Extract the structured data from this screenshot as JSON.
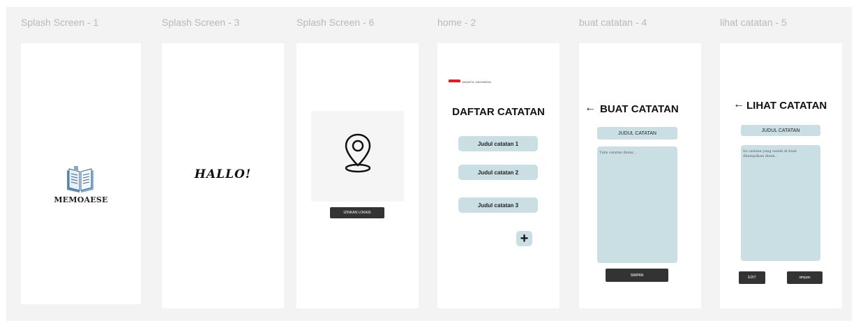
{
  "frames": [
    {
      "title": "Splash Screen - 1"
    },
    {
      "title": "Splash Screen - 3"
    },
    {
      "title": "Splash Screen - 6"
    },
    {
      "title": "home - 2"
    },
    {
      "title": "buat catatan - 4"
    },
    {
      "title": "lihat catatan - 5"
    }
  ],
  "splash1": {
    "logo_text": "MEMOAESE",
    "icon": "book-icon"
  },
  "splash3": {
    "greeting": "HALLO!"
  },
  "splash6": {
    "icon": "location-pin-icon",
    "button_label": "IZINKAN LOKASI"
  },
  "home": {
    "location": "JAKARTA, INDONESIA",
    "heading": "DAFTAR CATATAN",
    "notes": [
      "Judul catatan 1",
      "Judul catatan 2",
      "Judul catatan 3"
    ],
    "add_label": "+"
  },
  "buat": {
    "heading": "BUAT CATATAN",
    "title_placeholder": "JUDUL CATATAN",
    "body_placeholder": "Tulis catatan disini...",
    "save_label": "SIMPAN"
  },
  "lihat": {
    "heading": "LIHAT CATATAN",
    "title_value": "JUDUL CATATAN",
    "body_text": "Isi catatan yang sudah di buat ditampilkan disini..",
    "edit_label": "EDIT",
    "save_label": "simpan"
  },
  "colors": {
    "canvas": "#f3f3f3",
    "accent": "#cadfe3",
    "dark_button": "#333333",
    "flag_red": "#e51a22"
  }
}
